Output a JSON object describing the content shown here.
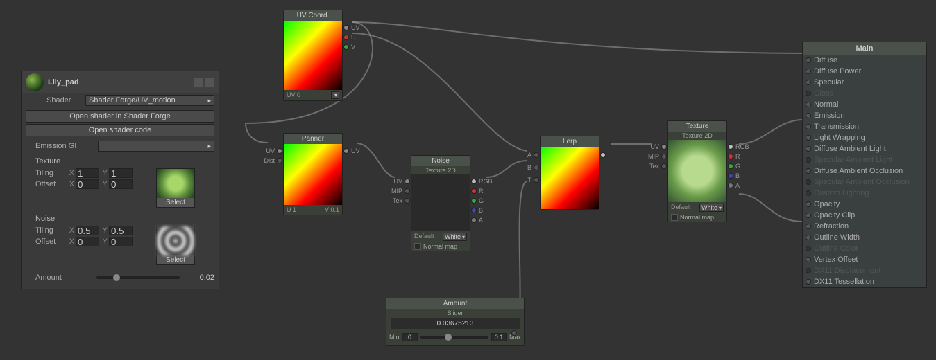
{
  "inspector": {
    "material_name": "Lily_pad",
    "shader_label": "Shader",
    "shader_value": "Shader Forge/UV_motion",
    "open_shader_forge": "Open shader in Shader Forge",
    "open_shader_code": "Open shader code",
    "emission_gi": "Emission GI",
    "texture": {
      "label": "Texture",
      "tiling": "Tiling",
      "offset": "Offset",
      "tiling_x": "1",
      "tiling_y": "1",
      "offset_x": "0",
      "offset_y": "0",
      "select": "Select"
    },
    "noise": {
      "label": "Noise",
      "tiling": "Tiling",
      "offset": "Offset",
      "tiling_x": "0.5",
      "tiling_y": "0.5",
      "offset_x": "0",
      "offset_y": "0",
      "select": "Select"
    },
    "amount": {
      "label": "Amount",
      "value": "0.02"
    }
  },
  "nodes": {
    "uv_coord": {
      "title": "UV Coord.",
      "foot": "UV 0",
      "out_uv": "UV",
      "out_u": "U",
      "out_v": "V"
    },
    "panner": {
      "title": "Panner",
      "in_uv": "UV",
      "in_dist": "Dist",
      "out_uv": "UV",
      "foot_u": "U 1",
      "foot_v": "V 0.1"
    },
    "noise": {
      "title": "Noise",
      "subtitle": "Texture 2D",
      "in_uv": "UV",
      "in_mip": "MIP",
      "in_tex": "Tex",
      "out_rgb": "RGB",
      "out_r": "R",
      "out_g": "G",
      "out_b": "B",
      "out_a": "A",
      "default": "Default",
      "default_val": "White",
      "normal_map": "Normal map"
    },
    "lerp": {
      "title": "Lerp",
      "in_a": "A",
      "in_b": "B",
      "in_t": "T"
    },
    "texture": {
      "title": "Texture",
      "subtitle": "Texture 2D",
      "in_uv": "UV",
      "in_mip": "MIP",
      "in_tex": "Tex",
      "out_rgb": "RGB",
      "out_r": "R",
      "out_g": "G",
      "out_b": "B",
      "out_a": "A",
      "default": "Default",
      "default_val": "White",
      "normal_map": "Normal map"
    },
    "amount": {
      "title": "Amount",
      "subtitle": "Slider",
      "value": "0.03675213",
      "min_label": "Min",
      "min": "0",
      "max_label": "Max",
      "max": "0.1"
    }
  },
  "main": {
    "title": "Main",
    "items": [
      {
        "label": "Diffuse",
        "enabled": true
      },
      {
        "label": "Diffuse Power",
        "enabled": true
      },
      {
        "label": "Specular",
        "enabled": true
      },
      {
        "label": "Gloss",
        "enabled": false
      },
      {
        "label": "Normal",
        "enabled": true
      },
      {
        "label": "Emission",
        "enabled": true
      },
      {
        "label": "Transmission",
        "enabled": true
      },
      {
        "label": "Light Wrapping",
        "enabled": true
      },
      {
        "label": "Diffuse Ambient Light",
        "enabled": true
      },
      {
        "label": "Specular Ambient Light",
        "enabled": false
      },
      {
        "label": "Diffuse Ambient Occlusion",
        "enabled": true
      },
      {
        "label": "Specular Ambient Occlusion",
        "enabled": false
      },
      {
        "label": "Custom Lighting",
        "enabled": false
      },
      {
        "label": "Opacity",
        "enabled": true
      },
      {
        "label": "Opacity Clip",
        "enabled": true
      },
      {
        "label": "Refraction",
        "enabled": true
      },
      {
        "label": "Outline Width",
        "enabled": true
      },
      {
        "label": "Outline Color",
        "enabled": false
      },
      {
        "label": "Vertex Offset",
        "enabled": true
      },
      {
        "label": "DX11 Displacement",
        "enabled": false
      },
      {
        "label": "DX11 Tessellation",
        "enabled": true
      }
    ]
  },
  "x_label": "X",
  "y_label": "Y"
}
